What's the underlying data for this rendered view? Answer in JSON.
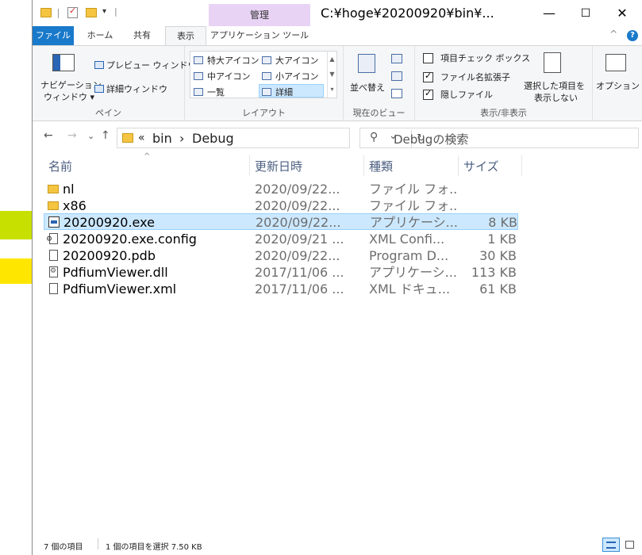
{
  "window": {
    "title": "C:¥hoge¥20200920¥bin¥...",
    "context_tab": "管理",
    "controls": {
      "minimize": "—",
      "maximize": "☐",
      "close": "✕"
    }
  },
  "quick_access": {
    "dropdown": "▾",
    "separator": "|"
  },
  "ribbon_tabs": [
    "ファイル",
    "ホーム",
    "共有",
    "表示",
    "アプリケーション ツール"
  ],
  "ribbon_help": {
    "collapse": "^",
    "help": "?"
  },
  "ribbon": {
    "pane": {
      "nav_pane_line1": "ナビゲーション",
      "nav_pane_line2": "ウィンドウ ▾",
      "preview": "プレビュー ウィンドウ",
      "details": "詳細ウィンドウ",
      "label": "ペイン"
    },
    "layout": {
      "items": [
        "特大アイコン",
        "大アイコン",
        "中アイコン",
        "小アイコン",
        "一覧",
        "詳細"
      ],
      "selected": "詳細",
      "label": "レイアウト"
    },
    "current_view": {
      "sort": "並べ替え",
      "label": "現在のビュー"
    },
    "show_hide": {
      "item_checkbox": "項目チェック ボックス",
      "extensions": "ファイル名拡張子",
      "hidden": "隠しファイル",
      "hide_selected_line1": "選択した項目を",
      "hide_selected_line2": "表示しない",
      "label": "表示/非表示"
    },
    "options": "オプション"
  },
  "address": {
    "crumbs": [
      "«",
      "bin",
      "›",
      "Debug"
    ],
    "refresh": "↻",
    "dropdown": "⌄"
  },
  "search": {
    "placeholder": "Debugの検索",
    "icon": "search-icon"
  },
  "nav": {
    "back": "←",
    "forward": "→",
    "recent": "⌄",
    "up": "↑"
  },
  "columns": [
    "名前",
    "更新日時",
    "種類",
    "サイズ"
  ],
  "sort_indicator": "^",
  "files": [
    {
      "name": "nl",
      "date": "2020/09/22...",
      "type": "ファイル フォ...",
      "size": "",
      "icon": "folder"
    },
    {
      "name": "x86",
      "date": "2020/09/22...",
      "type": "ファイル フォ...",
      "size": "",
      "icon": "folder"
    },
    {
      "name": "20200920.exe",
      "date": "2020/09/22...",
      "type": "アプリケーシ...",
      "size": "8 KB",
      "icon": "exe"
    },
    {
      "name": "20200920.exe.config",
      "date": "2020/09/21 ...",
      "type": "XML Confi...",
      "size": "1 KB",
      "icon": "cfg"
    },
    {
      "name": "20200920.pdb",
      "date": "2020/09/22...",
      "type": "Program D...",
      "size": "30 KB",
      "icon": "doc"
    },
    {
      "name": "PdfiumViewer.dll",
      "date": "2017/11/06 ...",
      "type": "アプリケーシ...",
      "size": "113 KB",
      "icon": "dll"
    },
    {
      "name": "PdfiumViewer.xml",
      "date": "2017/11/06 ...",
      "type": "XML ドキュ...",
      "size": "61 KB",
      "icon": "doc"
    }
  ],
  "selected_index": 2,
  "highlights": {
    "green": "#c8e000",
    "yellow": "#ffe600",
    "selection": "#cce8ff",
    "file_tab": "#1979ca"
  },
  "status": {
    "count": "7 個の項目",
    "selection": "1 個の項目を選択  7.50 KB"
  }
}
